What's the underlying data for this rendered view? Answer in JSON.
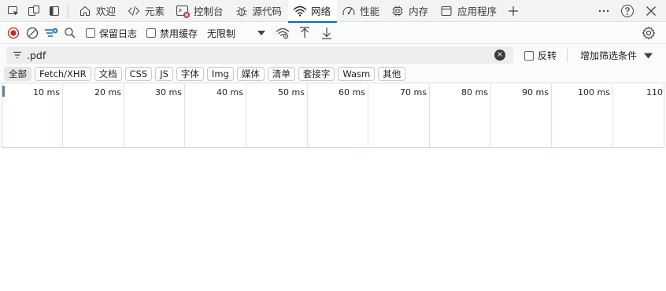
{
  "tabbar": {
    "tabs": [
      {
        "label": "欢迎",
        "icon": "home-icon"
      },
      {
        "label": "元素",
        "icon": "code-icon"
      },
      {
        "label": "控制台",
        "icon": "console-icon",
        "has_error_badge": true
      },
      {
        "label": "源代码",
        "icon": "bug-icon"
      },
      {
        "label": "网络",
        "icon": "wifi-icon",
        "active": true
      },
      {
        "label": "性能",
        "icon": "performance-icon"
      },
      {
        "label": "内存",
        "icon": "memory-icon"
      },
      {
        "label": "应用程序",
        "icon": "application-icon"
      }
    ]
  },
  "toolbar": {
    "preserve_log": "保留日志",
    "disable_cache": "禁用缓存",
    "throttling": "无限制"
  },
  "filter": {
    "value": ".pdf",
    "invert_label": "反转",
    "more_filters": "增加筛选条件"
  },
  "types": [
    "全部",
    "Fetch/XHR",
    "文档",
    "CSS",
    "JS",
    "字体",
    "Img",
    "媒体",
    "清单",
    "套接字",
    "Wasm",
    "其他"
  ],
  "timeline": {
    "ticks": [
      "10 ms",
      "20 ms",
      "30 ms",
      "40 ms",
      "50 ms",
      "60 ms",
      "70 ms",
      "80 ms",
      "90 ms",
      "100 ms",
      "110"
    ]
  },
  "colors": {
    "accent": "#0f6cbd",
    "record_red": "#c42b1c",
    "error_badge": "#d13438"
  }
}
